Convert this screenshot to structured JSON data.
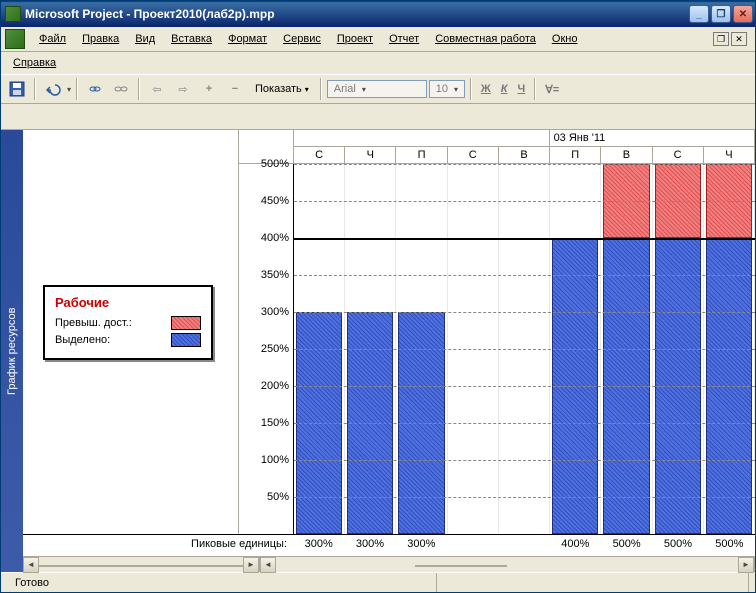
{
  "title": "Microsoft Project - Проект2010(лаб2р).mpp",
  "menu": [
    "Файл",
    "Правка",
    "Вид",
    "Вставка",
    "Формат",
    "Сервис",
    "Проект",
    "Отчет",
    "Совместная работа",
    "Окно"
  ],
  "menu2": [
    "Справка"
  ],
  "toolbar": {
    "show": "Показать",
    "font": "Arial",
    "size": "10"
  },
  "sidebar_label": "График ресурсов",
  "legend": {
    "title": "Рабочие",
    "overalloc": "Превыш. дост.:",
    "allocated": "Выделено:"
  },
  "timescale": {
    "week2": "03 Янв '11",
    "days": [
      "С",
      "Ч",
      "П",
      "С",
      "В",
      "П",
      "В",
      "С",
      "Ч"
    ]
  },
  "yaxis": [
    "500%",
    "450%",
    "400%",
    "350%",
    "300%",
    "250%",
    "200%",
    "150%",
    "100%",
    "50%"
  ],
  "peak": {
    "label": "Пиковые единицы:",
    "values": [
      "300%",
      "300%",
      "300%",
      "",
      "",
      "400%",
      "500%",
      "500%",
      "500%"
    ]
  },
  "status": "Готово",
  "chart_data": {
    "type": "bar",
    "title": "Рабочие",
    "ylabel": "Пиковые единицы",
    "ylim": [
      0,
      500
    ],
    "allocation_line": 400,
    "categories": [
      "С",
      "Ч",
      "П",
      "С",
      "В",
      "П",
      "В",
      "С",
      "Ч"
    ],
    "series": [
      {
        "name": "Выделено",
        "values": [
          300,
          300,
          300,
          0,
          0,
          400,
          400,
          400,
          400
        ]
      },
      {
        "name": "Превыш. дост.",
        "values": [
          0,
          0,
          0,
          0,
          0,
          0,
          100,
          100,
          100
        ]
      }
    ],
    "totals": [
      300,
      300,
      300,
      0,
      0,
      400,
      500,
      500,
      500
    ]
  }
}
